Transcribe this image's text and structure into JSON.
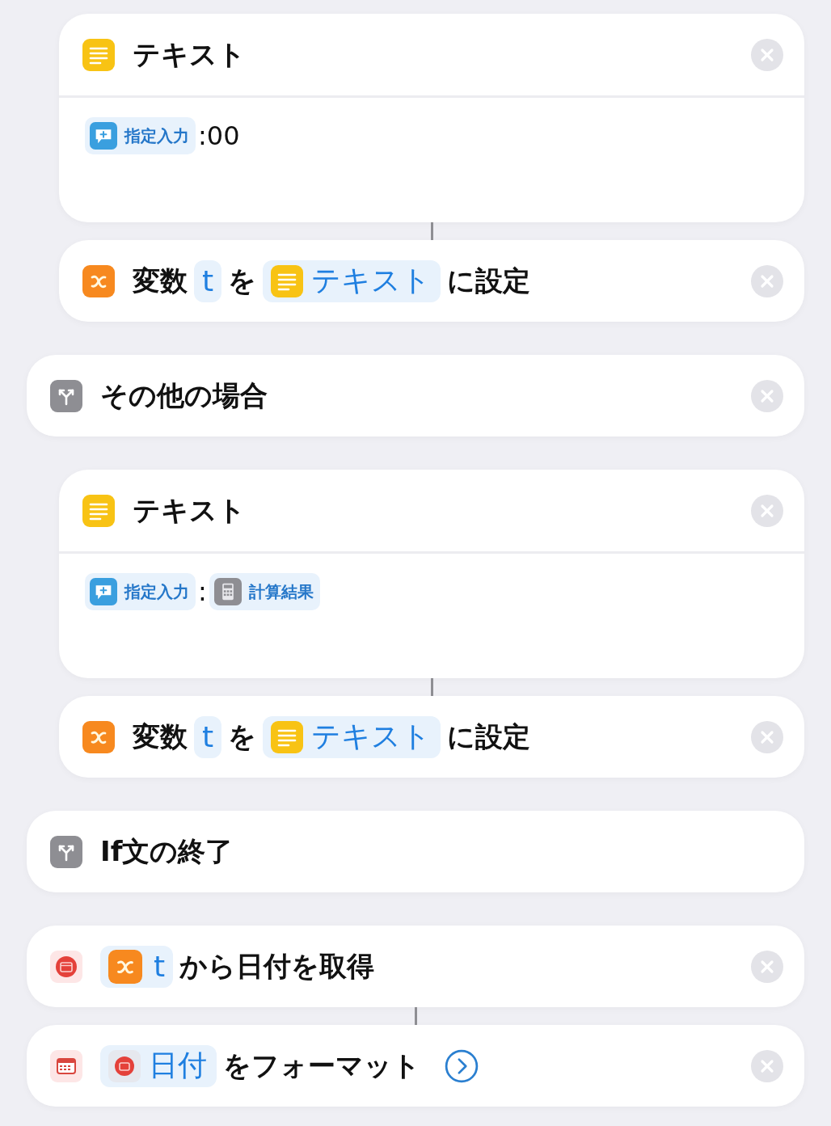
{
  "actions": [
    {
      "kind": "group",
      "children": [
        {
          "kind": "text",
          "linked": false,
          "title": "テキスト",
          "body": [
            {
              "kind": "ask_token",
              "text": "指定入力"
            },
            {
              "kind": "literal",
              "text": ":00"
            }
          ]
        },
        {
          "kind": "set_variable",
          "linked": true,
          "parts": [
            {
              "kind": "label",
              "text": "変数"
            },
            {
              "kind": "var_token",
              "text": "t"
            },
            {
              "kind": "label",
              "text": "を"
            },
            {
              "kind": "text_token",
              "text": "テキスト"
            },
            {
              "kind": "label",
              "text": "に設定"
            }
          ]
        }
      ]
    },
    {
      "kind": "otherwise",
      "title": "その他の場合",
      "children": [
        {
          "kind": "text",
          "linked": false,
          "title": "テキスト",
          "body": [
            {
              "kind": "ask_token",
              "text": "指定入力"
            },
            {
              "kind": "literal",
              "text": ":"
            },
            {
              "kind": "calc_token",
              "text": "計算結果"
            }
          ]
        },
        {
          "kind": "set_variable",
          "linked": true,
          "parts": [
            {
              "kind": "label",
              "text": "変数"
            },
            {
              "kind": "var_token",
              "text": "t"
            },
            {
              "kind": "label",
              "text": "を"
            },
            {
              "kind": "text_token",
              "text": "テキスト"
            },
            {
              "kind": "label",
              "text": "に設定"
            }
          ]
        }
      ]
    },
    {
      "kind": "end_if",
      "title": "If文の終了"
    },
    {
      "kind": "get_date",
      "linked": false,
      "parts": [
        {
          "kind": "xvar_token",
          "text": "t"
        },
        {
          "kind": "label",
          "text": "から日付を取得"
        }
      ]
    },
    {
      "kind": "format_date",
      "linked": true,
      "parts": [
        {
          "kind": "date_token",
          "text": "日付"
        },
        {
          "kind": "label",
          "text": "をフォーマット"
        },
        {
          "kind": "expand"
        }
      ]
    }
  ]
}
